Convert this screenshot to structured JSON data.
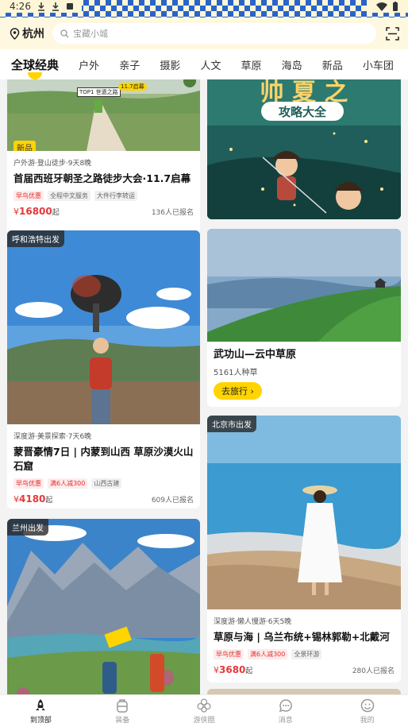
{
  "status": {
    "time": "4:26",
    "icons_left": [
      "download-icon",
      "download-icon",
      "app-icon"
    ],
    "icons_right": [
      "wifi-icon",
      "battery-icon"
    ]
  },
  "topbar": {
    "city": "杭州",
    "search_placeholder": "宝藏小城"
  },
  "tabs": [
    "全球经典",
    "户外",
    "亲子",
    "摄影",
    "人文",
    "草原",
    "海岛",
    "新品",
    "小车团"
  ],
  "cards": {
    "c1": {
      "new_tag": "新品",
      "meta": "户外游·登山徒步·9天8晚",
      "title": "首届西班牙朝圣之路徒步大会·11.7启幕",
      "badges": [
        "早鸟优惠",
        "全程中文服务",
        "大件行李转运"
      ],
      "price_prefix": "¥",
      "price": "16800",
      "price_suffix": "起",
      "signed": "136人已报名",
      "img_text_1": "TOP1 世遗之路",
      "img_text_2": "11.7启幕"
    },
    "c2": {
      "img_text": "攻略大全"
    },
    "c3": {
      "depart": "呼和浩特出发",
      "meta": "深度游·美景探索·7天6晚",
      "title": "蒙晋豪情7日 | 内蒙到山西 草原沙漠火山石窟",
      "badges": [
        "早鸟优惠",
        "满6人减300",
        "山西古建"
      ],
      "price_prefix": "¥",
      "price": "4180",
      "price_suffix": "起",
      "signed": "609人已报名"
    },
    "c4": {
      "title": "武功山—云中草原",
      "meta": "5161人种草",
      "button": "去旅行 ›"
    },
    "c5": {
      "depart": "北京市出发",
      "meta": "深度游·懒人慢游·6天5晚",
      "title": "草原与海 | 乌兰布统+锡林郭勒+北戴河",
      "badges": [
        "早鸟优惠",
        "满6人减300",
        "全景环游"
      ],
      "price_prefix": "¥",
      "price": "3680",
      "price_suffix": "起",
      "signed": "280人已报名"
    },
    "c6": {
      "depart": "兰州出发"
    }
  },
  "nav": [
    {
      "label": "到顶部",
      "icon": "rocket-icon",
      "active": true
    },
    {
      "label": "装备",
      "icon": "backpack-icon",
      "active": false
    },
    {
      "label": "游侠圈",
      "icon": "flower-icon",
      "active": false
    },
    {
      "label": "消息",
      "icon": "chat-icon",
      "active": false
    },
    {
      "label": "我的",
      "icon": "smile-icon",
      "active": false
    }
  ],
  "colors": {
    "accent": "#ffd400",
    "price": "#e4393c",
    "topbar_bg": "#fff8e1"
  }
}
